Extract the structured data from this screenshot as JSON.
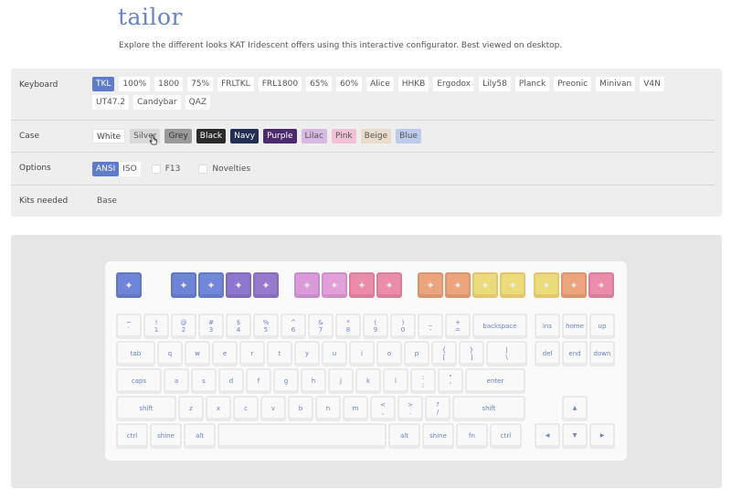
{
  "header": {
    "title": "tailor",
    "subtitle": "Explore the different looks KAT Iridescent offers using this interactive configurator. Best viewed on desktop."
  },
  "config": {
    "keyboard": {
      "label": "Keyboard",
      "options": [
        "TKL",
        "100%",
        "1800",
        "75%",
        "FRLTKL",
        "FRL1800",
        "65%",
        "60%",
        "Alice",
        "HHKB",
        "Ergodox",
        "Lily58",
        "Planck",
        "Preonic",
        "Minivan",
        "V4N",
        "UT47.2",
        "Candybar",
        "QAZ"
      ],
      "selected": "TKL"
    },
    "case": {
      "label": "Case",
      "options": [
        {
          "name": "White",
          "bg": "#ffffff",
          "fg": "#444444"
        },
        {
          "name": "Silver",
          "bg": "#d9d9d9",
          "fg": "#555555"
        },
        {
          "name": "Grey",
          "bg": "#9a9a9a",
          "fg": "#333333"
        },
        {
          "name": "Black",
          "bg": "#2b2b2b",
          "fg": "#ffffff"
        },
        {
          "name": "Navy",
          "bg": "#232f55",
          "fg": "#ffffff"
        },
        {
          "name": "Purple",
          "bg": "#4d2a6e",
          "fg": "#ffffff"
        },
        {
          "name": "Lilac",
          "bg": "#d8b9e2",
          "fg": "#555555"
        },
        {
          "name": "Pink",
          "bg": "#f2c1d6",
          "fg": "#555555"
        },
        {
          "name": "Beige",
          "bg": "#e9dccb",
          "fg": "#555555"
        },
        {
          "name": "Blue",
          "bg": "#bccbec",
          "fg": "#555555"
        }
      ]
    },
    "options": {
      "label": "Options",
      "layouts": [
        "ANSI",
        "ISO"
      ],
      "selected_layout": "ANSI",
      "toggles": [
        {
          "label": "F13",
          "checked": false
        },
        {
          "label": "Novelties",
          "checked": false
        }
      ]
    },
    "kits": {
      "label": "Kits needed",
      "value": "Base"
    }
  },
  "keyboard_preview": {
    "fn_row": [
      {
        "color": "#6b82d6"
      },
      {
        "color": "#6b82d6"
      },
      {
        "color": "#6f86d8"
      },
      {
        "color": "#8c74cc"
      },
      {
        "color": "#9577cc"
      },
      {
        "color": "#d79ad8"
      },
      {
        "color": "#df9ed6"
      },
      {
        "color": "#ec8aa9"
      },
      {
        "color": "#ec8aa9"
      },
      {
        "color": "#f0a27a"
      },
      {
        "color": "#f0a27a"
      },
      {
        "color": "#f6d879"
      },
      {
        "color": "#f6d879"
      },
      {
        "color": "#f6d879"
      },
      {
        "color": "#f0a27a"
      },
      {
        "color": "#ec8aa9"
      }
    ],
    "number_row": [
      "~\n`",
      "!\n1",
      "@\n2",
      "#\n3",
      "$\n4",
      "%\n5",
      "^\n6",
      "&\n7",
      "*\n8",
      "(\n9",
      ")\n0",
      "_\n-",
      "+\n=",
      "backspace"
    ],
    "top_row": [
      "tab",
      "q",
      "w",
      "e",
      "r",
      "t",
      "y",
      "u",
      "i",
      "o",
      "p",
      "{\n[",
      "}\n]",
      "|\n\\"
    ],
    "home_row": [
      "caps",
      "a",
      "s",
      "d",
      "f",
      "g",
      "h",
      "j",
      "k",
      "l",
      ":\n;",
      "\"\n'",
      "enter"
    ],
    "bottom_row": [
      "shift",
      "z",
      "x",
      "c",
      "v",
      "b",
      "n",
      "m",
      "<\n,",
      ">\n.",
      "?\n/",
      "shift"
    ],
    "mod_row": [
      "ctrl",
      "shine",
      "alt",
      "",
      "alt",
      "shine",
      "fn",
      "ctrl"
    ],
    "nav_cluster": [
      "ins",
      "home",
      "up",
      "del",
      "end",
      "down"
    ],
    "arrow_icons": [
      "arrow-up-icon",
      "arrow-left-icon",
      "arrow-down-icon",
      "arrow-right-icon"
    ]
  }
}
